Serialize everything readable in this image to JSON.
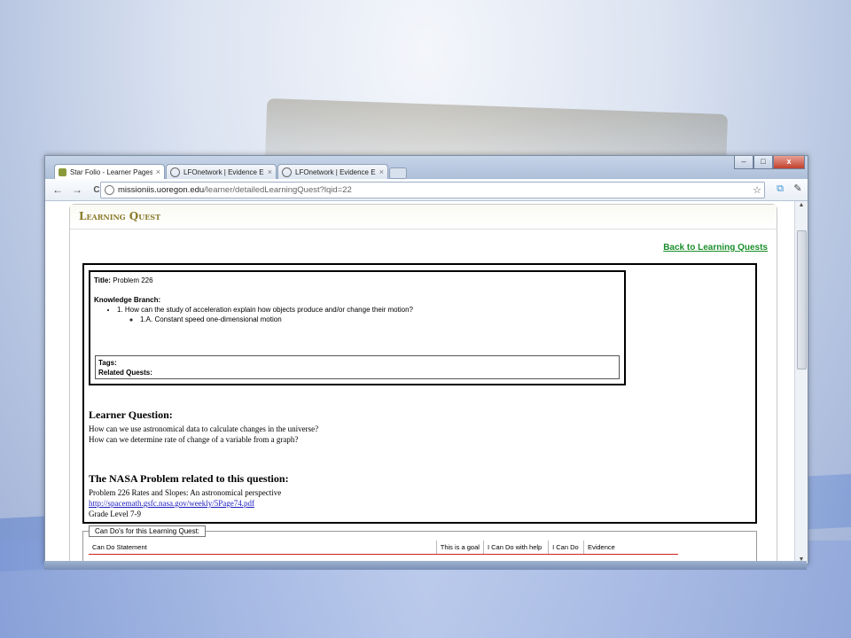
{
  "browser": {
    "tabs": [
      {
        "label": "Star Folio - Learner Pages",
        "close": "×",
        "active": true
      },
      {
        "label": "LFOnetwork | Evidence Exar",
        "close": "×",
        "active": false
      },
      {
        "label": "LFOnetwork | Evidence Exar",
        "close": "×",
        "active": false
      }
    ],
    "window_controls": {
      "minimize": "–",
      "maximize": "□",
      "close": "x"
    },
    "nav": {
      "back": "←",
      "forward": "→",
      "reload": "C"
    },
    "url_host": "missioniis.uoregon.edu",
    "url_path": "/learner/detailedLearningQuest?lqid=22",
    "icons": {
      "bookmark": "star-icon",
      "page": "page-icon",
      "wrench": "wrench-icon"
    }
  },
  "page": {
    "header": "Learning Quest",
    "back_link": "Back to Learning Quests",
    "info": {
      "title_label": "Title:",
      "title_value": "Problem 226",
      "kb_label": "Knowledge Branch:",
      "kb_items": [
        {
          "text": "1. How can the study of acceleration explain how objects produce and/or change their motion?",
          "sub": [
            "1.A. Constant speed one-dimensional motion"
          ]
        }
      ],
      "tags_label": "Tags:",
      "related_label": "Related Quests:"
    },
    "learner_question": {
      "heading": "Learner Question:",
      "lines": [
        "How can we use astronomical data to calculate changes in the universe?",
        "How can we determine rate of change of a variable from a graph?"
      ]
    },
    "nasa": {
      "heading": "The NASA Problem related to this question:",
      "problem": "Problem 226 Rates and Slopes: An astronomical perspective",
      "link": "http://spacemath.gsfc.nasa.gov/weekly/5Page74.pdf",
      "grade": "Grade Level 7-9"
    },
    "cando": {
      "legend": "Can Do's for this Learning Quest:",
      "columns": [
        "Can Do Statement",
        "This is a goal",
        "I Can Do with help",
        "I Can Do",
        "Evidence"
      ]
    }
  }
}
